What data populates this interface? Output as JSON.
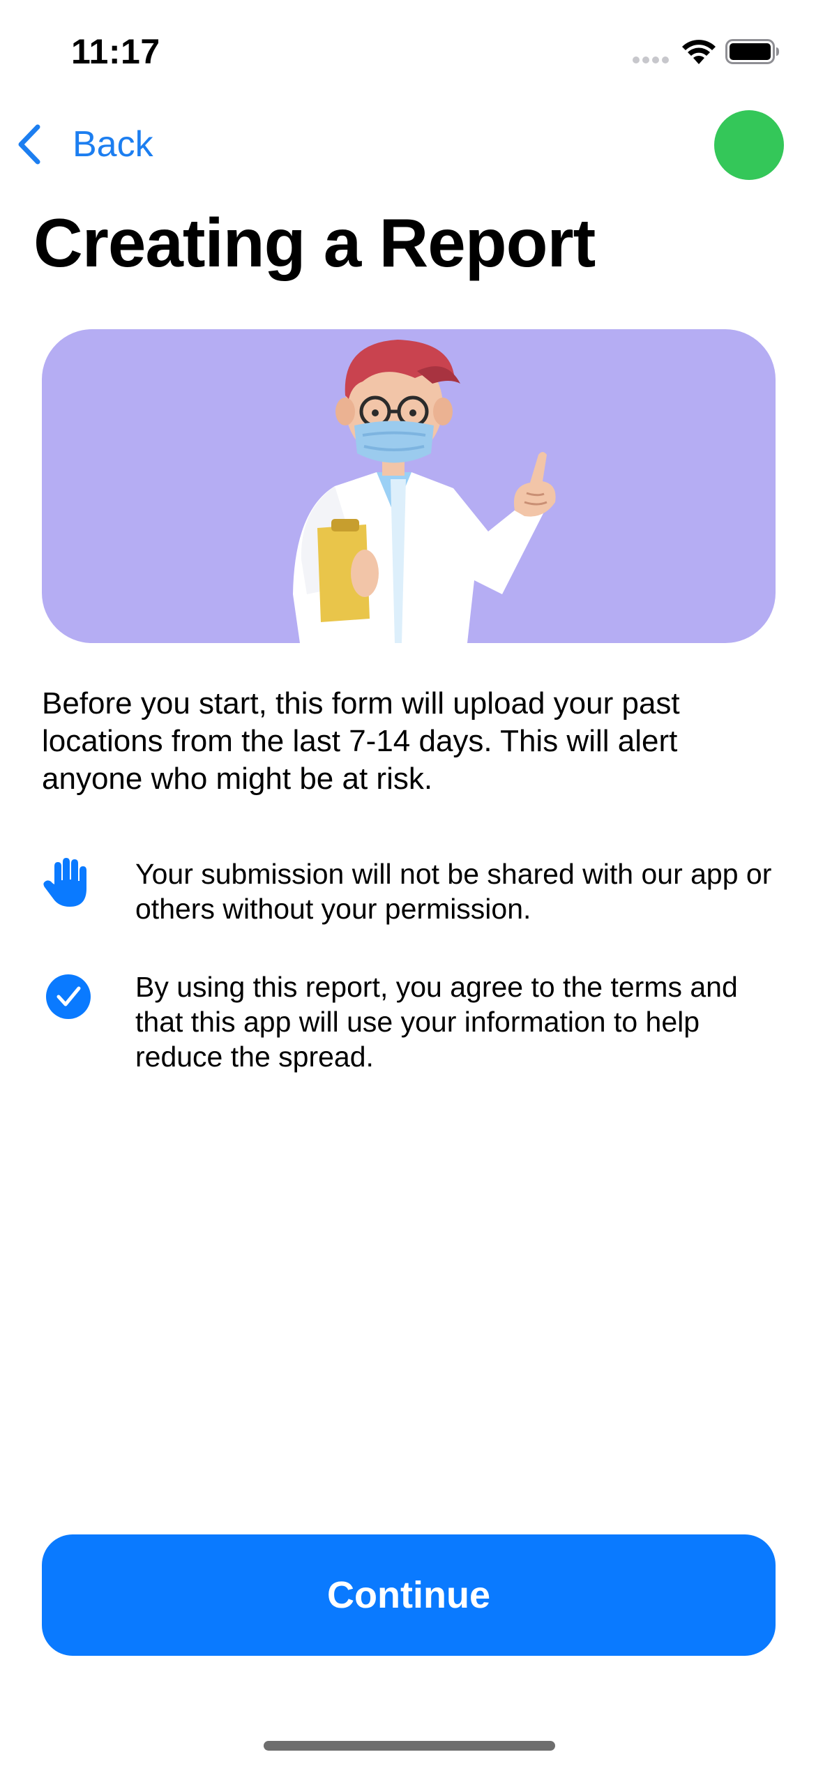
{
  "status_bar": {
    "time": "11:17"
  },
  "nav": {
    "back_label": "Back",
    "status_dot_color": "#34C759"
  },
  "title": "Creating a Report",
  "hero": {
    "illustration": "doctor-with-mask-pointing",
    "background_color": "#B5ADF3"
  },
  "intro_text": "Before you start, this form will upload your past locations from the last 7-14 days. This will alert anyone who might be at risk.",
  "info_rows": [
    {
      "icon": "hand-raised-icon",
      "text": "Your submission will not be shared with our app or others without your permission."
    },
    {
      "icon": "checkmark-circle-icon",
      "text": "By using this report, you agree to the terms and that this app will use your information to help reduce the spread."
    }
  ],
  "continue_label": "Continue",
  "accent_color": "#0A7AFF"
}
